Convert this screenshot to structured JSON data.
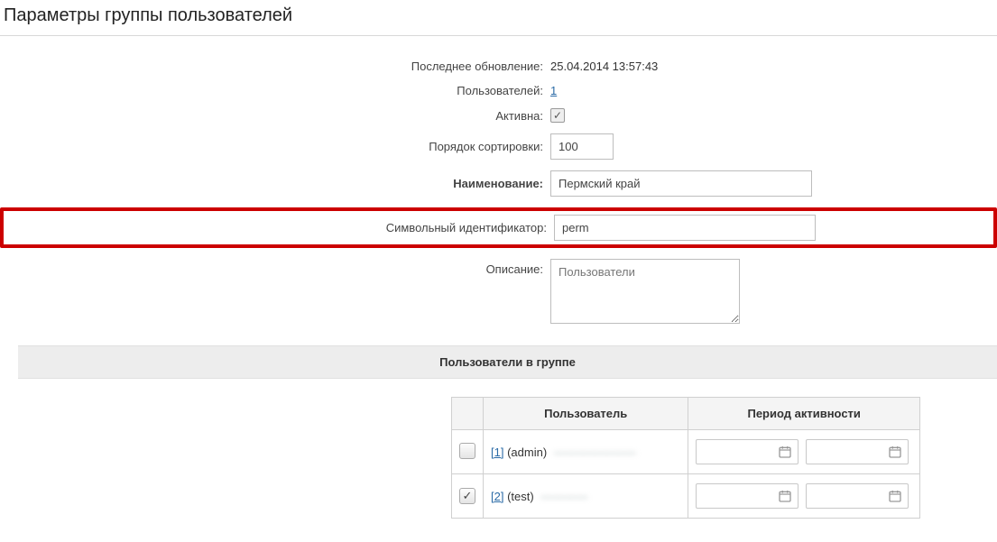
{
  "title": "Параметры группы пользователей",
  "form": {
    "last_update_label": "Последнее обновление:",
    "last_update_value": "25.04.2014 13:57:43",
    "users_label": "Пользователей:",
    "users_count": "1",
    "active_label": "Активна:",
    "active_checked": true,
    "sort_label": "Порядок сортировки:",
    "sort_value": "100",
    "name_label": "Наименование:",
    "name_value": "Пермский край",
    "sid_label": "Символьный идентификатор:",
    "sid_value": "perm",
    "desc_label": "Описание:",
    "desc_value": "Пользователи "
  },
  "section_users_title": "Пользователи в группе",
  "table": {
    "col_user": "Пользователь",
    "col_period": "Период активности",
    "rows": [
      {
        "checked": false,
        "id_link": "[1]",
        "login": "(admin)",
        "name_blur": "———————"
      },
      {
        "checked": true,
        "id_link": "[2]",
        "login": "(test)",
        "name_blur": "————"
      }
    ]
  }
}
